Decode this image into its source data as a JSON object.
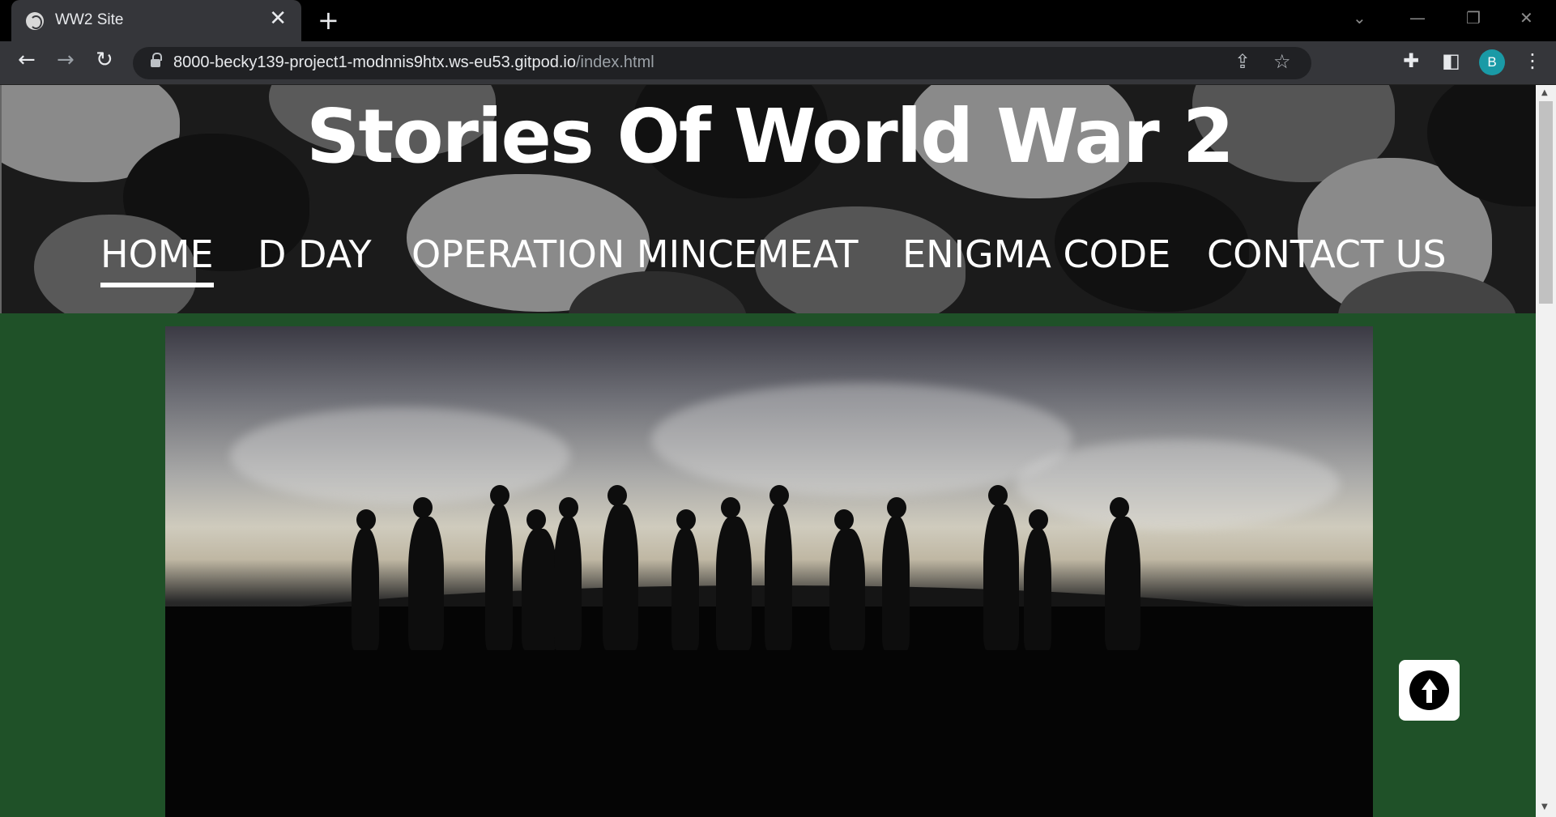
{
  "browser": {
    "tab_title": "WW2 Site",
    "tab_close": "✕",
    "new_tab": "+",
    "url_host": "8000-becky139-project1-modnnis9htx.ws-eu53.gitpod.io",
    "url_path": "/index.html",
    "profile_initial": "B",
    "icons": [
      "globe-icon",
      "back-icon",
      "forward-icon",
      "reload-icon",
      "lock-icon",
      "share-icon",
      "star-icon",
      "extensions-icon",
      "side-panel-icon",
      "menu-icon"
    ]
  },
  "site": {
    "title": "Stories Of World War 2",
    "nav": [
      {
        "label": "HOME",
        "active": true
      },
      {
        "label": "D DAY",
        "active": false
      },
      {
        "label": "OPERATION MINCEMEAT",
        "active": false
      },
      {
        "label": "ENIGMA CODE",
        "active": false
      },
      {
        "label": "CONTACT US",
        "active": false
      }
    ],
    "colors": {
      "background": "#1f5128",
      "header_camo_dark": "#111111",
      "header_camo_light": "#888888"
    }
  }
}
